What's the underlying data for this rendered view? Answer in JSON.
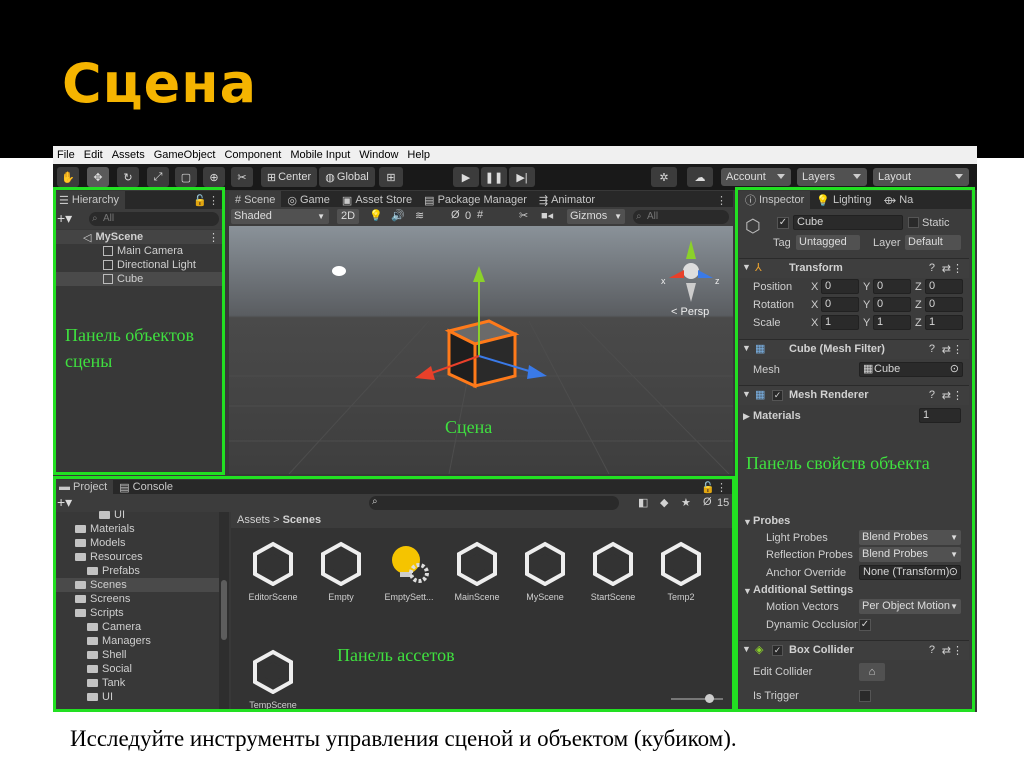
{
  "slide": {
    "title": "Сцена",
    "caption": "Исследуйте инструменты управления сценой и объектом (кубиком)."
  },
  "menu": [
    "File",
    "Edit",
    "Assets",
    "GameObject",
    "Component",
    "Mobile Input",
    "Window",
    "Help"
  ],
  "toolbar": {
    "pivot": "Center",
    "space": "Global",
    "account": "Account",
    "layers": "Layers",
    "layout": "Layout"
  },
  "hierarchy": {
    "tab": "Hierarchy",
    "search_placeholder": "All",
    "scene": "MyScene",
    "items": [
      "Main Camera",
      "Directional Light",
      "Cube"
    ]
  },
  "scene_tabs": {
    "tabs": [
      "Scene",
      "Game",
      "Asset Store",
      "Package Manager",
      "Animator"
    ],
    "shading": "Shaded",
    "mode_2d": "2D",
    "hidden_count": "0",
    "gizmos": "Gizmos",
    "search_placeholder": "All",
    "persp": "Persp",
    "axis_x": "x",
    "axis_z": "z"
  },
  "inspector": {
    "tabs": [
      "Inspector",
      "Lighting",
      "Na"
    ],
    "object_name": "Cube",
    "static_label": "Static",
    "tag_label": "Tag",
    "tag_value": "Untagged",
    "layer_label": "Layer",
    "layer_value": "Default",
    "transform": {
      "title": "Transform",
      "rows": [
        {
          "label": "Position",
          "x": "0",
          "y": "0",
          "z": "0"
        },
        {
          "label": "Rotation",
          "x": "0",
          "y": "0",
          "z": "0"
        },
        {
          "label": "Scale",
          "x": "1",
          "y": "1",
          "z": "1"
        }
      ]
    },
    "mesh_filter": {
      "title": "Cube (Mesh Filter)",
      "mesh_label": "Mesh",
      "mesh_value": "Cube"
    },
    "mesh_renderer": {
      "title": "Mesh Renderer",
      "materials_label": "Materials",
      "materials_count": "1"
    },
    "probes": {
      "title": "Probes",
      "light_label": "Light Probes",
      "light_value": "Blend Probes",
      "reflection_label": "Reflection Probes",
      "reflection_value": "Blend Probes",
      "anchor_label": "Anchor Override",
      "anchor_value": "None (Transform)"
    },
    "additional": {
      "title": "Additional Settings",
      "motion_label": "Motion Vectors",
      "motion_value": "Per Object Motion",
      "occlusion_label": "Dynamic Occlusion"
    },
    "box_collider": {
      "title": "Box Collider",
      "edit_label": "Edit Collider",
      "trigger_label": "Is Trigger"
    }
  },
  "project": {
    "tabs": [
      "Project",
      "Console"
    ],
    "tree": [
      {
        "label": "UI",
        "indent": 3
      },
      {
        "label": "Materials",
        "indent": 1
      },
      {
        "label": "Models",
        "indent": 1
      },
      {
        "label": "Resources",
        "indent": 1
      },
      {
        "label": "Prefabs",
        "indent": 2
      },
      {
        "label": "Scenes",
        "indent": 1
      },
      {
        "label": "Screens",
        "indent": 1
      },
      {
        "label": "Scripts",
        "indent": 1
      },
      {
        "label": "Camera",
        "indent": 2
      },
      {
        "label": "Managers",
        "indent": 2
      },
      {
        "label": "Shell",
        "indent": 2
      },
      {
        "label": "Social",
        "indent": 2
      },
      {
        "label": "Tank",
        "indent": 2
      },
      {
        "label": "UI",
        "indent": 2
      }
    ],
    "breadcrumb_root": "Assets",
    "breadcrumb_current": "Scenes",
    "hidden_count": "15",
    "assets": [
      "EditorScene",
      "Empty",
      "EmptySett...",
      "MainScene",
      "MyScene",
      "StartScene",
      "Temp2",
      "TempScene"
    ]
  },
  "overlay_labels": {
    "hierarchy": "Панель объектов сцены",
    "scene": "Сцена",
    "inspector": "Панель свойств объекта",
    "assets": "Панель ассетов"
  },
  "colors": {
    "highlight": "#22e022",
    "title": "#f5b400",
    "label": "#3fe03f"
  }
}
